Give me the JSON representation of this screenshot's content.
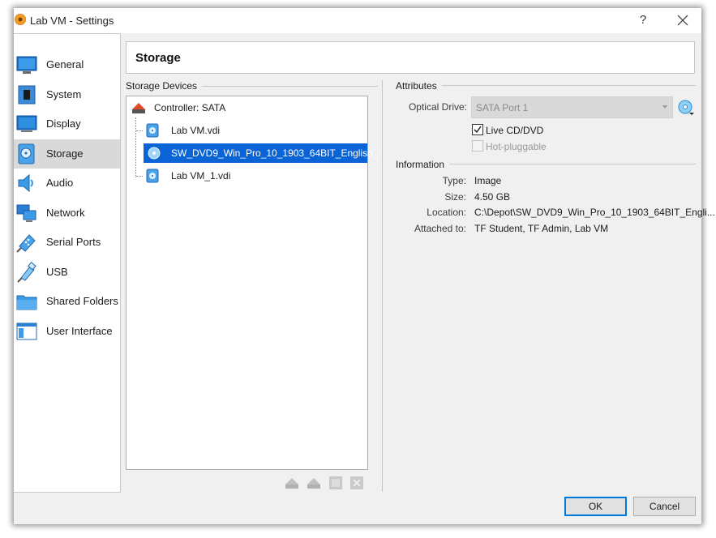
{
  "window": {
    "title": "Lab VM - Settings",
    "help": "?"
  },
  "sidebar": {
    "items": [
      {
        "label": "General",
        "icon": "general-icon"
      },
      {
        "label": "System",
        "icon": "system-icon"
      },
      {
        "label": "Display",
        "icon": "display-icon"
      },
      {
        "label": "Storage",
        "icon": "storage-icon",
        "selected": true
      },
      {
        "label": "Audio",
        "icon": "audio-icon"
      },
      {
        "label": "Network",
        "icon": "network-icon"
      },
      {
        "label": "Serial Ports",
        "icon": "serial-ports-icon"
      },
      {
        "label": "USB",
        "icon": "usb-icon"
      },
      {
        "label": "Shared Folders",
        "icon": "shared-folders-icon"
      },
      {
        "label": "User Interface",
        "icon": "user-interface-icon"
      }
    ]
  },
  "page": {
    "title": "Storage"
  },
  "storage_devices": {
    "title": "Storage Devices",
    "controller": "Controller: SATA",
    "attachments": [
      {
        "label": "Lab VM.vdi",
        "icon": "hard-disk-icon"
      },
      {
        "label": "SW_DVD9_Win_Pro_10_1903_64BIT_English_...",
        "icon": "optical-disc-icon",
        "selected": true
      },
      {
        "label": "Lab VM_1.vdi",
        "icon": "hard-disk-icon"
      }
    ]
  },
  "attributes": {
    "title": "Attributes",
    "optical_drive_label": "Optical Drive:",
    "optical_drive_value": "SATA Port 1",
    "live_cd_label": "Live CD/DVD",
    "live_cd_checked": true,
    "hot_pluggable_label": "Hot-pluggable",
    "hot_pluggable_checked": false
  },
  "information": {
    "title": "Information",
    "type_label": "Type:",
    "type_value": "Image",
    "size_label": "Size:",
    "size_value": "4.50 GB",
    "location_label": "Location:",
    "location_value": "C:\\Depot\\SW_DVD9_Win_Pro_10_1903_64BIT_Engli...",
    "attached_label": "Attached to:",
    "attached_value": "TF Student, TF Admin, Lab VM"
  },
  "buttons": {
    "ok": "OK",
    "cancel": "Cancel"
  },
  "colors": {
    "selection": "#0a64d6",
    "default_button_border": "#0078d7"
  }
}
